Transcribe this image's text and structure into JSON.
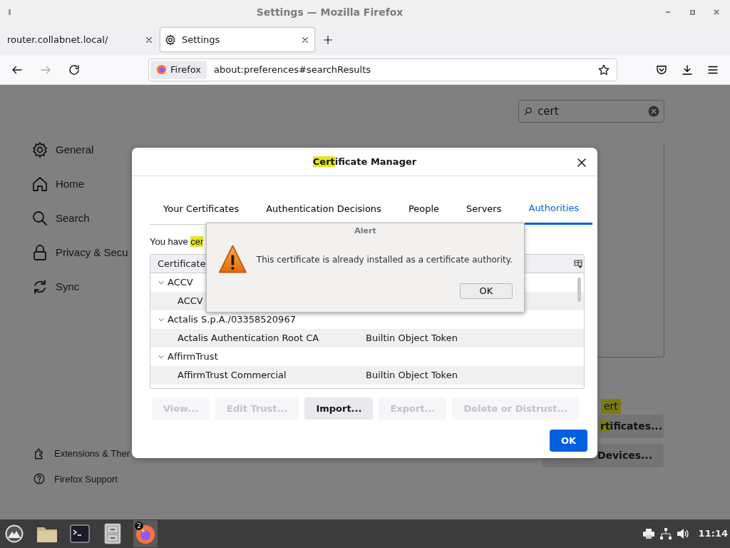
{
  "window": {
    "title": "Settings — Mozilla Firefox"
  },
  "tabs": [
    {
      "label": "router.collabnet.local/",
      "selected": false,
      "icon": false
    },
    {
      "label": "Settings",
      "selected": true,
      "icon": true
    }
  ],
  "toolbar": {
    "back_disabled": false,
    "forward_disabled": true,
    "identity": "Firefox",
    "url": "about:preferences#searchResults"
  },
  "search": {
    "value": "cert"
  },
  "sidebar": {
    "items": [
      {
        "label": "General",
        "kind": "gear"
      },
      {
        "label": "Home",
        "kind": "home"
      },
      {
        "label": "Search",
        "kind": "search"
      },
      {
        "label": "Privacy & Secu",
        "kind": "lock"
      },
      {
        "label": "Sync",
        "kind": "sync"
      }
    ],
    "footer": [
      {
        "label": "Extensions & Ther",
        "kind": "puzzle"
      },
      {
        "label": "Firefox Support",
        "kind": "help"
      }
    ]
  },
  "background_controls": [
    {
      "kind": "text",
      "highlight": "ert"
    },
    {
      "kind": "button",
      "highlight": "rt",
      "rest": "ificates..."
    },
    {
      "kind": "button",
      "rest": "Devices..."
    }
  ],
  "cert_manager": {
    "title": {
      "highlight": "Cert",
      "rest": "ificate Manager"
    },
    "tabs": [
      {
        "label": "Your Certificates",
        "selected": false
      },
      {
        "label": "Authentication Decisions",
        "selected": false
      },
      {
        "label": "People",
        "selected": false
      },
      {
        "label": "Servers",
        "selected": false
      },
      {
        "label": "Authorities",
        "selected": true
      }
    ],
    "intro": {
      "text": "You have ",
      "highlight": "cer"
    },
    "columns": [
      "Certificate"
    ],
    "rows": [
      {
        "label": "ACCV",
        "expanded": true,
        "children": [
          {
            "name": "ACCV"
          }
        ]
      },
      {
        "label": "Actalis S.p.A./03358520967",
        "expanded": true,
        "children": [
          {
            "name": "Actalis Authentication Root CA",
            "token": "Builtin Object Token"
          }
        ]
      },
      {
        "label": "AffirmTrust",
        "expanded": true,
        "children": [
          {
            "name": "AffirmTrust Commercial",
            "token": "Builtin Object Token"
          }
        ]
      }
    ],
    "buttons": [
      {
        "label": "View...",
        "disabled": true
      },
      {
        "label": "Edit Trust...",
        "disabled": true
      },
      {
        "label": "Import...",
        "disabled": false
      },
      {
        "label": "Export...",
        "disabled": true
      },
      {
        "label": "Delete or Distrust...",
        "disabled": true
      }
    ],
    "ok": "OK"
  },
  "alert": {
    "title": "Alert",
    "message": "This certificate is already installed as a certificate authority.",
    "ok": "OK"
  },
  "taskbar": {
    "badge": "2",
    "time": "11:14"
  }
}
